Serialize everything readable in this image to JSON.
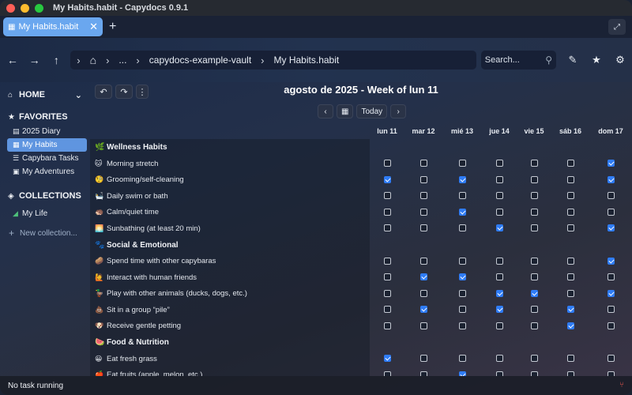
{
  "window": {
    "title": "My Habits.habit - Capydocs 0.9.1"
  },
  "tabs": [
    {
      "label": "My Habits.habit",
      "close": "✕"
    }
  ],
  "tabbar": {
    "new_tab": "+"
  },
  "breadcrumb": [
    "...",
    "capydocs-example-vault",
    "My Habits.habit"
  ],
  "search": {
    "placeholder": "Search..."
  },
  "sidebar": {
    "home": "HOME",
    "favorites_title": "FAVORITES",
    "favorites": [
      {
        "label": "2025 Diary",
        "icon": "doc-icon"
      },
      {
        "label": "My Habits",
        "icon": "calendar-icon",
        "active": true
      },
      {
        "label": "Capybara Tasks",
        "icon": "tasks-icon"
      },
      {
        "label": "My Adventures",
        "icon": "grid-icon"
      }
    ],
    "collections_title": "COLLECTIONS",
    "collections": [
      {
        "label": "My Life",
        "icon": "collection-icon"
      }
    ],
    "new_collection": "New collection..."
  },
  "main": {
    "week_title": "agosto de 2025 - Week of lun 11",
    "today_label": "Today",
    "days": [
      "lun 11",
      "mar 12",
      "mié 13",
      "jue 14",
      "vie 15",
      "sáb 16",
      "dom 17"
    ],
    "categories": [
      {
        "name": "Wellness Habits",
        "emoji": "🌿",
        "habits": [
          {
            "name": "Morning stretch",
            "emoji": "🐱",
            "checks": [
              false,
              false,
              false,
              false,
              false,
              false,
              true
            ]
          },
          {
            "name": "Grooming/self-cleaning",
            "emoji": "🧐",
            "checks": [
              true,
              false,
              true,
              false,
              false,
              false,
              true
            ]
          },
          {
            "name": "Daily swim or bath",
            "emoji": "🛀",
            "checks": [
              false,
              false,
              false,
              false,
              false,
              false,
              false
            ]
          },
          {
            "name": "Calm/quiet time",
            "emoji": "🦔",
            "checks": [
              false,
              false,
              true,
              false,
              false,
              false,
              false
            ]
          },
          {
            "name": "Sunbathing (at least 20 min)",
            "emoji": "🌅",
            "checks": [
              false,
              false,
              false,
              true,
              false,
              false,
              true
            ]
          }
        ]
      },
      {
        "name": "Social & Emotional",
        "emoji": "🐾",
        "habits": [
          {
            "name": "Spend time with other capybaras",
            "emoji": "🥔",
            "checks": [
              false,
              false,
              false,
              false,
              false,
              false,
              true
            ]
          },
          {
            "name": "Interact with human friends",
            "emoji": "🙋",
            "checks": [
              false,
              true,
              true,
              false,
              false,
              false,
              false
            ]
          },
          {
            "name": "Play with other animals (ducks, dogs, etc.)",
            "emoji": "🦆",
            "checks": [
              false,
              false,
              false,
              true,
              true,
              false,
              true
            ]
          },
          {
            "name": "Sit in a group “pile”",
            "emoji": "💩",
            "checks": [
              false,
              true,
              false,
              true,
              false,
              true,
              false
            ]
          },
          {
            "name": "Receive gentle petting",
            "emoji": "🐶",
            "checks": [
              false,
              false,
              false,
              false,
              false,
              true,
              false
            ]
          }
        ]
      },
      {
        "name": "Food & Nutrition",
        "emoji": "🍉",
        "habits": [
          {
            "name": "Eat fresh grass",
            "emoji": "😀",
            "checks": [
              true,
              false,
              false,
              false,
              false,
              false,
              false
            ]
          },
          {
            "name": "Eat fruits (apple, melon, etc.)",
            "emoji": "🍎",
            "checks": [
              false,
              false,
              true,
              false,
              false,
              false,
              false
            ]
          }
        ]
      }
    ]
  },
  "status": {
    "text": "No task running"
  },
  "colors": {
    "accent": "#5f95e0",
    "checkbox_checked": "#2f7cf6",
    "tab_active": "#6aa7ef"
  }
}
